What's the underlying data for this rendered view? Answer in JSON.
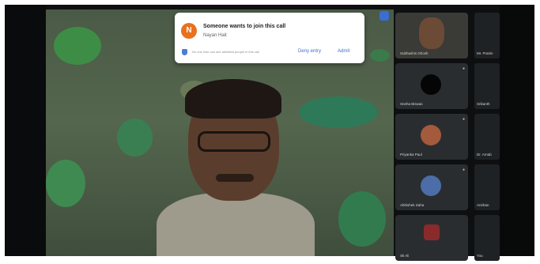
{
  "notification": {
    "avatar_letter": "N",
    "title": "Someone wants to join this call",
    "name": "Nayan Hait",
    "info": "No one else can see admitted people in this call",
    "deny_label": "Deny entry",
    "admit_label": "Admit"
  },
  "tiles": [
    {
      "name": "Subhashis Ghosh",
      "side_name": "Mr. Pratim"
    },
    {
      "name": "Sneha Biswas",
      "side_name": "Srikanth"
    },
    {
      "name": "Priyanka Paul",
      "side_name": "Dr. Arnab"
    },
    {
      "name": "Abhishek Saha",
      "side_name": "Anirban"
    },
    {
      "name": "Sk Ali",
      "side_name": "You"
    }
  ],
  "colors": {
    "notification_accent": "#3c6fd1",
    "avatar_bg": "#e8711f"
  }
}
